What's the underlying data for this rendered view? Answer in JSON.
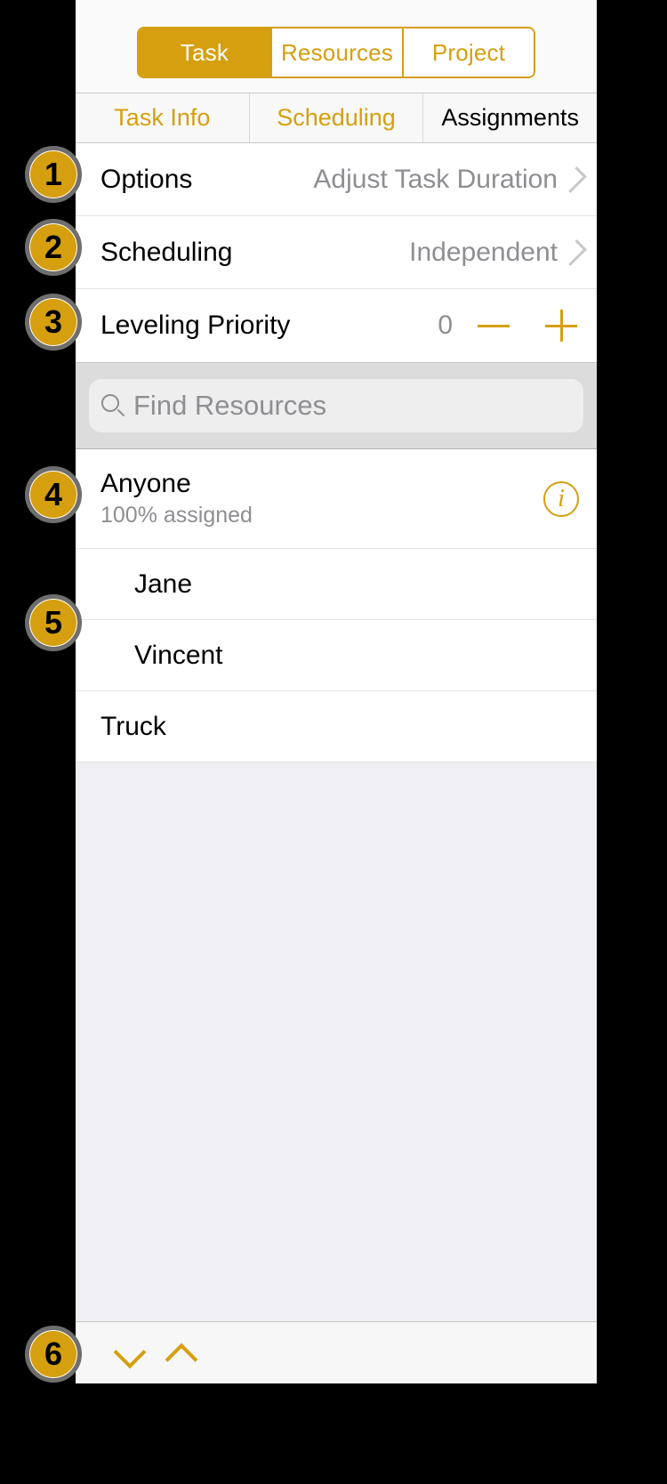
{
  "header": {
    "segments": [
      "Task",
      "Resources",
      "Project"
    ],
    "active_index": 0
  },
  "subtabs": {
    "items": [
      "Task Info",
      "Scheduling",
      "Assignments"
    ],
    "selected_index": 2
  },
  "settings": {
    "options": {
      "label": "Options",
      "value": "Adjust Task Duration"
    },
    "scheduling": {
      "label": "Scheduling",
      "value": "Independent"
    },
    "leveling": {
      "label": "Leveling Priority",
      "value": "0"
    }
  },
  "search": {
    "placeholder": "Find Resources"
  },
  "resources": {
    "group": {
      "name": "Anyone",
      "subtitle": "100% assigned"
    },
    "members": [
      "Jane",
      "Vincent"
    ],
    "items": [
      "Truck"
    ]
  },
  "callouts": [
    "1",
    "2",
    "3",
    "4",
    "5",
    "6"
  ]
}
